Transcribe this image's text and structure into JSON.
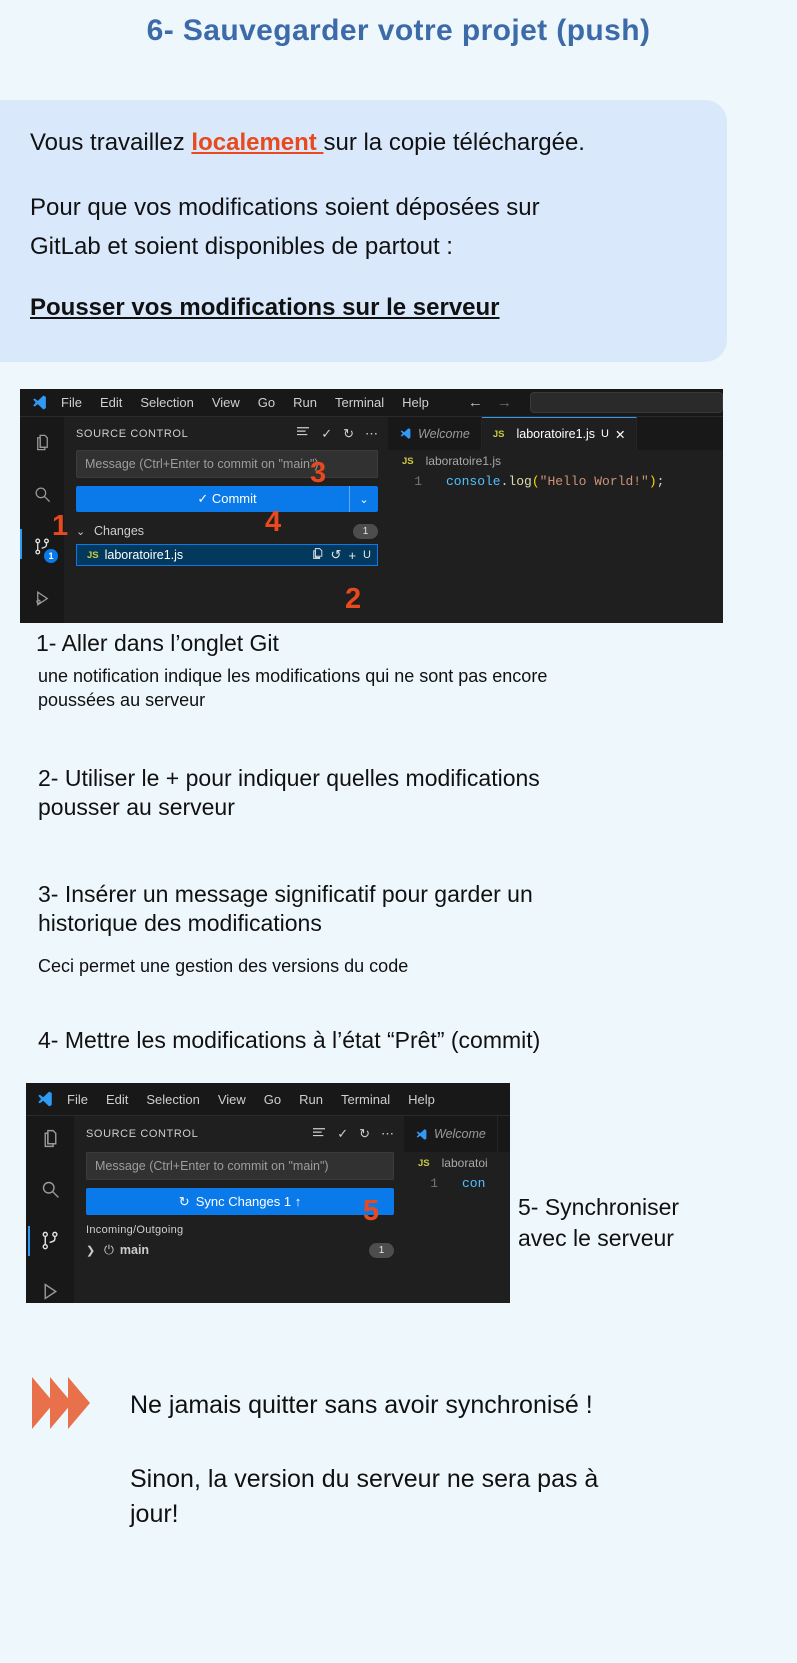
{
  "page": {
    "title": "6- Sauvegarder votre projet (push)",
    "background_color": "#eef8fc",
    "title_color": "#3d6aa8",
    "accent_color": "#e8491d",
    "card_color": "#d9e9fb"
  },
  "intro": {
    "line1_before": "Vous travaillez ",
    "line1_highlight": "localement ",
    "line1_after": "sur la copie téléchargée.",
    "line2": "Pour que vos modifications soient déposées sur",
    "line3": "GitLab et soient disponibles de partout :",
    "heading": "Pousser vos modifications sur le serveur"
  },
  "vscode1": {
    "menu": [
      "File",
      "Edit",
      "Selection",
      "View",
      "Go",
      "Run",
      "Terminal",
      "Help"
    ],
    "source_control_title": "SOURCE CONTROL",
    "message_placeholder": "Message (Ctrl+Enter to commit on \"main\")",
    "commit_label": "✓ Commit",
    "changes_label": "Changes",
    "changes_count": "1",
    "file_name": "laboratoire1.js",
    "file_badge": "JS",
    "file_status": "U",
    "activity_badge": "1",
    "tabs": [
      {
        "label": "Welcome",
        "icon": "vscode-logo-icon",
        "active": false
      },
      {
        "label": "laboratoire1.js",
        "icon": "js-file-icon",
        "status": "U",
        "active": true
      }
    ],
    "breadcrumb": "laboratoire1.js",
    "code_line_number": "1",
    "code_tokens": {
      "object": "console",
      "dot": ".",
      "func": "log",
      "open": "(",
      "string": "\"Hello World!\"",
      "close": ")",
      "semi": ";"
    }
  },
  "vscode2": {
    "menu": [
      "File",
      "Edit",
      "Selection",
      "View",
      "Go",
      "Run",
      "Terminal",
      "Help"
    ],
    "source_control_title": "SOURCE CONTROL",
    "message_placeholder": "Message (Ctrl+Enter to commit on \"main\")",
    "sync_label": "Sync Changes 1 ↑",
    "incoming_outgoing_label": "Incoming/Outgoing",
    "branch_name": "main",
    "branch_count": "1",
    "tab_welcome": "Welcome",
    "breadcrumb": "laboratoi",
    "code_line_number": "1",
    "code_snippet": "con"
  },
  "callouts": {
    "one": "1",
    "two": "2",
    "three": "3",
    "four": "4",
    "five": "5"
  },
  "steps": [
    {
      "title": "1-  Aller dans l’onglet Git",
      "sub": "une notification indique les modifications qui ne sont pas encore\npoussées au serveur"
    },
    {
      "title": "2- Utiliser le + pour indiquer quelles modifications\npousser au serveur",
      "sub": ""
    },
    {
      "title": "3- Insérer un message significatif pour garder un\nhistorique des modifications",
      "sub": "Ceci permet une gestion des versions du code"
    },
    {
      "title": "4-  Mettre les modifications à l’état “Prêt” (commit)",
      "sub": ""
    }
  ],
  "side_note": "5- Synchroniser\navec le serveur",
  "warning": {
    "headline": "Ne jamais quitter sans avoir synchronisé !",
    "body": "Sinon, la version du serveur ne sera pas à\njour!",
    "chevron_color": "#e8704a"
  }
}
